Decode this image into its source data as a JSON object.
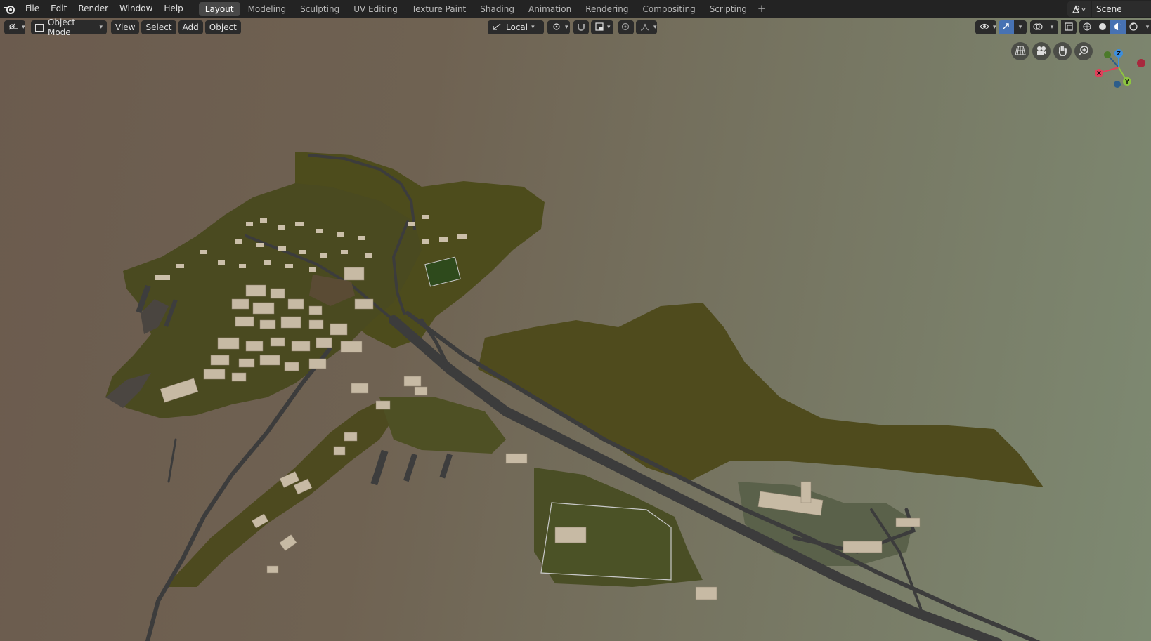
{
  "menu": {
    "items": [
      "File",
      "Edit",
      "Render",
      "Window",
      "Help"
    ]
  },
  "workspaces": {
    "tabs": [
      "Layout",
      "Modeling",
      "Sculpting",
      "UV Editing",
      "Texture Paint",
      "Shading",
      "Animation",
      "Rendering",
      "Compositing",
      "Scripting"
    ],
    "active": "Layout",
    "add_label": "+"
  },
  "scene": {
    "name": "Scene",
    "icon": "scene-icon"
  },
  "viewport_header": {
    "editor_type_icon": "3d-viewport-icon",
    "mode": "Object Mode",
    "menus": [
      "View",
      "Select",
      "Add",
      "Object"
    ],
    "transform_orientation": "Local",
    "pivot_icon": "pivot-icon",
    "snap_icon": "magnet-icon",
    "proportional_icon": "proportional-editing-icon"
  },
  "navigation": {
    "buttons": [
      "perspective-grid-icon",
      "camera-icon",
      "hand-pan-icon",
      "zoom-icon"
    ]
  },
  "gizmo": {
    "axes": [
      "X",
      "Y",
      "Z"
    ],
    "colors": {
      "x": "#e0405a",
      "y": "#8dc63f",
      "z": "#3c8fe0"
    }
  },
  "colors": {
    "accent": "#4772b3",
    "terrain": "#4f4e1f",
    "road": "#3d3d3d",
    "building": "#c9bca6"
  }
}
